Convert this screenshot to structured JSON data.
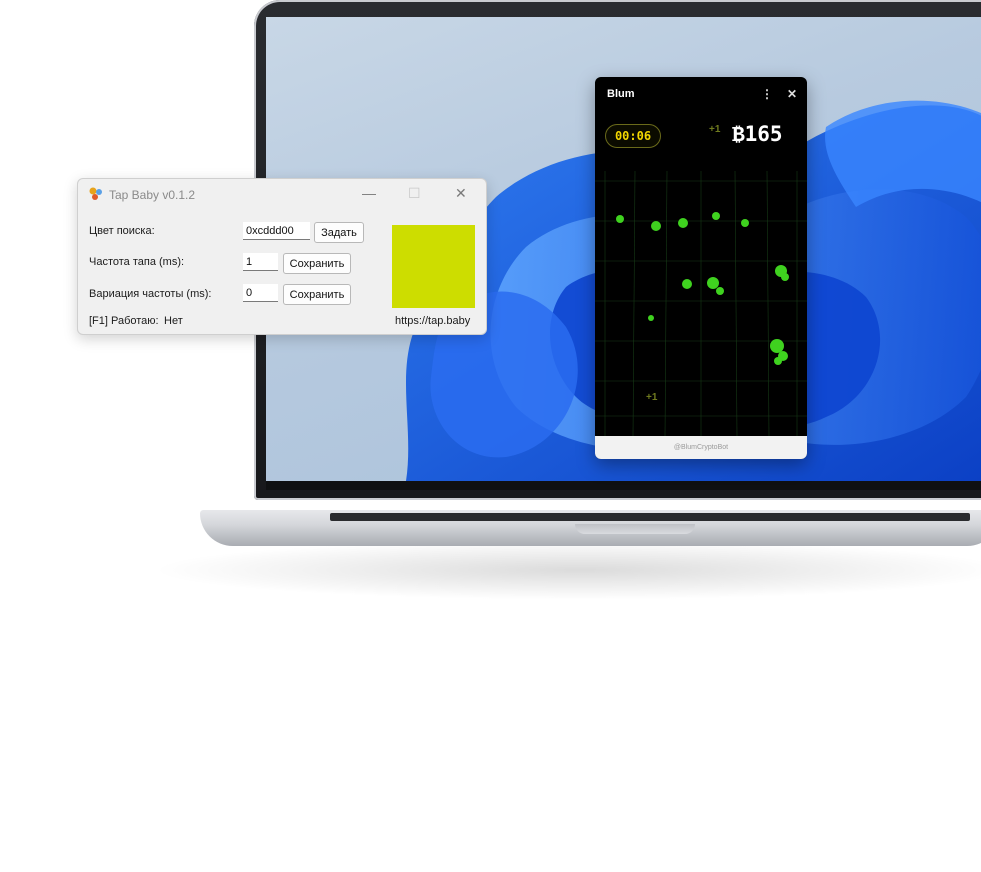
{
  "tapbaby": {
    "title": "Tap Baby v0.1.2",
    "search_color_label": "Цвет поиска:",
    "search_color_value": "0xcddd00",
    "set_button": "Задать",
    "tap_freq_label": "Частота тапа (ms):",
    "tap_freq_value": "1",
    "save_button": "Сохранить",
    "freq_variation_label": "Вариация частоты (ms):",
    "freq_variation_value": "0",
    "save_button_2": "Сохранить",
    "status_label": "[F1] Работаю:",
    "status_value": "Нет",
    "link": "https://tap.baby",
    "swatch_color": "#cddd00",
    "window_controls": [
      "minimize-icon",
      "maximize-icon",
      "close-icon"
    ]
  },
  "blum": {
    "title": "Blum",
    "timer": "00:06",
    "score": "165",
    "currency_symbol": "₿",
    "plus_one": "+1",
    "footer": "@BlumCryptoBot",
    "controls": [
      "more-vertical-icon",
      "close-icon"
    ],
    "accent_color": "#f2d600",
    "clover_color": "#3fd21f"
  },
  "colors": {
    "wallpaper_blue": "#1f5fe0",
    "laptop_bezel": "#1c1d20",
    "laptop_base": "#d5d7db"
  }
}
